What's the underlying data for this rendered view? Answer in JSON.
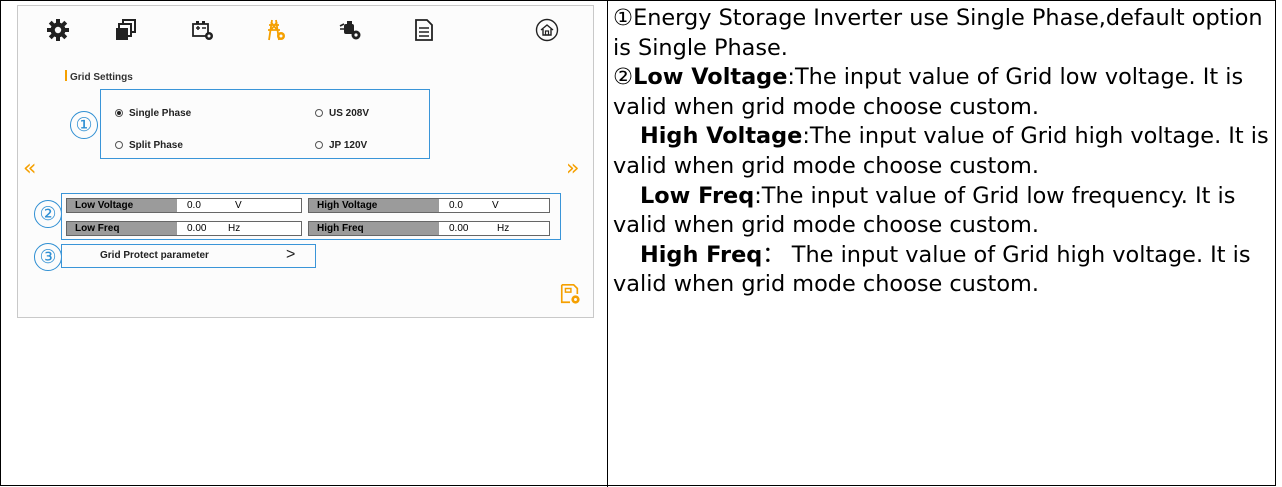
{
  "toolbar": {
    "icons": [
      "gear-icon",
      "layers-icon",
      "battery-settings-icon",
      "grid-tower-icon",
      "generator-icon",
      "document-icon",
      "home-icon"
    ],
    "active_icon": "grid-tower-icon",
    "active_color": "#f5a000"
  },
  "grid_settings": {
    "title": "Grid Settings",
    "markers": [
      "①",
      "②",
      "③"
    ],
    "phase_options": [
      {
        "label": "Single Phase",
        "selected": true
      },
      {
        "label": "US 208V",
        "selected": false
      },
      {
        "label": "Split Phase",
        "selected": false
      },
      {
        "label": "JP 120V",
        "selected": false
      }
    ],
    "fields": {
      "low_voltage": {
        "label": "Low Voltage",
        "value": "0.0",
        "unit": "V"
      },
      "high_voltage": {
        "label": "High Voltage",
        "value": "0.0",
        "unit": "V"
      },
      "low_freq": {
        "label": "Low Freq",
        "value": "0.00",
        "unit": "Hz"
      },
      "high_freq": {
        "label": "High Freq",
        "value": "0.00",
        "unit": "Hz"
      }
    },
    "protect_button": "Grid Protect parameter",
    "chevron": ">",
    "prev_arrow": "«",
    "next_arrow": "»",
    "accent_color": "#3a95d8"
  },
  "description": {
    "p1": "①Energy Storage Inverter use Single Phase,default option is Single Phase.",
    "p2_prefix": "②",
    "low_voltage_term": "Low Voltage",
    "low_voltage_text": ":The input value of Grid low voltage. It is valid when grid mode choose custom.",
    "high_voltage_term": "High Voltage",
    "high_voltage_text": ":The input value of Grid high voltage. It is valid when grid mode choose custom.",
    "low_freq_term": "Low Freq",
    "low_freq_text": ":The input value of Grid low frequency. It is valid when grid mode choose custom.",
    "high_freq_term": "High Freq",
    "high_freq_text": "： The input value of Grid high voltage. It is valid when grid mode choose custom."
  }
}
